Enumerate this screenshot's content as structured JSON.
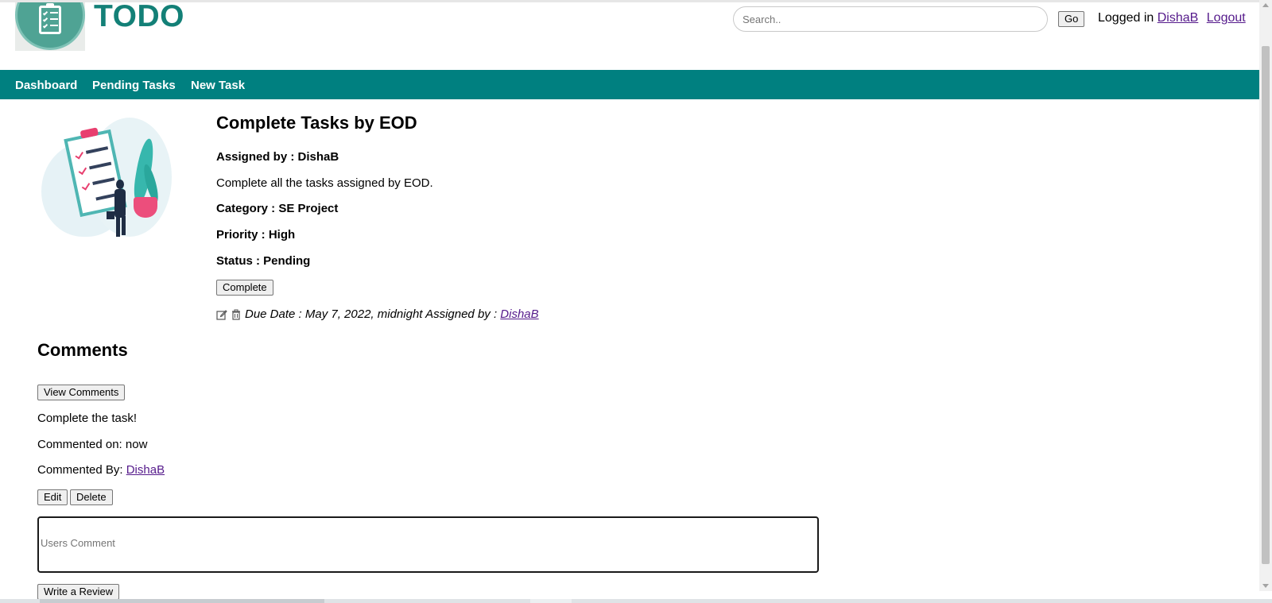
{
  "header": {
    "brand": "TODO",
    "search_placeholder": "Search..",
    "go_label": "Go",
    "logged_in_text": "Logged in",
    "username": "DishaB",
    "logout_label": "Logout"
  },
  "nav": {
    "items": [
      {
        "label": "Dashboard"
      },
      {
        "label": "Pending Tasks"
      },
      {
        "label": "New Task"
      }
    ]
  },
  "task": {
    "title": "Complete Tasks by EOD",
    "assigned_by_label": "Assigned by : DishaB",
    "description": "Complete all the tasks assigned by EOD.",
    "category": "Category : SE Project",
    "priority": "Priority : High",
    "status": "Status : Pending",
    "complete_label": "Complete",
    "due_text": "Due Date : May 7, 2022, midnight Assigned by :",
    "due_user": "DishaB",
    "icons": [
      "edit-icon",
      "trash-icon"
    ]
  },
  "comments": {
    "heading": "Comments",
    "view_label": "View Comments",
    "text": "Complete the task!",
    "commented_on": "Commented on: now",
    "commented_by_label": "Commented By:",
    "commented_by_user": "DishaB",
    "edit_label": "Edit",
    "delete_label": "Delete",
    "input_placeholder": "Users Comment",
    "review_label": "Write a Review"
  },
  "colors": {
    "brand": "#138077",
    "navbar": "#008080",
    "link": "#551a8b"
  }
}
